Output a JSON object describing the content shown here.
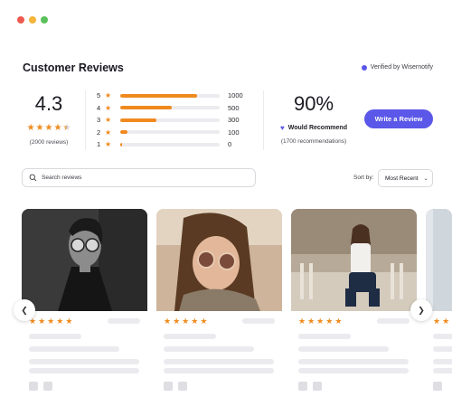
{
  "window": {
    "traffic_lights": [
      "#ee5a52",
      "#f5b43a",
      "#5ac15a"
    ]
  },
  "header": {
    "title": "Customer Reviews",
    "verified_text": "Verified by Wisernotify"
  },
  "summary": {
    "average": "4.3",
    "average_rating_value": 4.3,
    "review_count_text": "(2000 reviews)",
    "rating_breakdown": [
      {
        "stars": "5",
        "count": "1000",
        "fraction": 0.77
      },
      {
        "stars": "4",
        "count": "500",
        "fraction": 0.52
      },
      {
        "stars": "3",
        "count": "300",
        "fraction": 0.36
      },
      {
        "stars": "2",
        "count": "100",
        "fraction": 0.07
      },
      {
        "stars": "1",
        "count": "0",
        "fraction": 0.02
      }
    ],
    "recommend_percent": "90%",
    "recommend_label": "Would Recommend",
    "recommend_count_text": "(1700 recommendations)"
  },
  "actions": {
    "write_review_label": "Write a Review"
  },
  "search": {
    "placeholder": "Search reviews"
  },
  "sort": {
    "label": "Sort by:",
    "selected": "Most Recent"
  },
  "reviews": [
    {
      "rating": 5
    },
    {
      "rating": 5
    },
    {
      "rating": 5
    },
    {
      "rating": 5
    }
  ],
  "colors": {
    "accent": "#5b57e8",
    "star": "#f08a1e",
    "skeleton": "#ebebef"
  },
  "icons": {
    "search": "search-icon",
    "heart": "heart-icon",
    "chevron": "chevron-down-icon",
    "prev": "chevron-left-icon",
    "next": "chevron-right-icon"
  }
}
